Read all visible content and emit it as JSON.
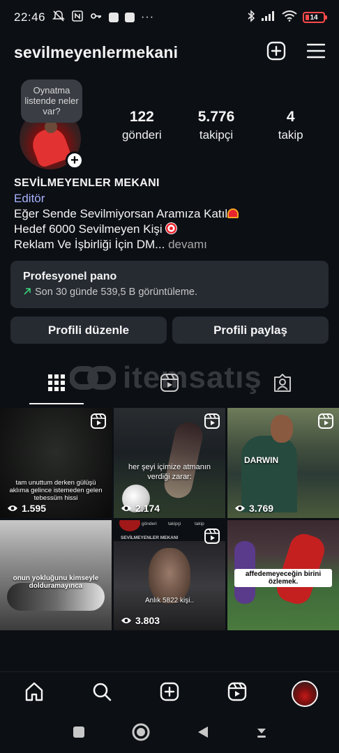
{
  "status_bar": {
    "time": "22:46",
    "battery": "14",
    "icons": [
      "mute-icon",
      "nfc-icon",
      "key-icon",
      "app-icon",
      "app-icon",
      "more-icon",
      "bluetooth-icon",
      "signal-icon",
      "wifi-icon",
      "battery-icon"
    ]
  },
  "header": {
    "username": "sevilmeyenlermekani",
    "icons": [
      "create-post-icon",
      "menu-icon"
    ]
  },
  "profile": {
    "note": "Oynatma listende neler var?",
    "stats": [
      {
        "value": "122",
        "label": "gönderi"
      },
      {
        "value": "5.776",
        "label": "takipçi"
      },
      {
        "value": "4",
        "label": "takip"
      }
    ],
    "display_name": "SEVİLMEYENLER MEKANI",
    "category": "Editör",
    "bio_line1": "Eğer Sende Sevilmiyorsan Aramıza Katıl",
    "bio_line2": "Hedef 6000 Sevilmeyen Kişi",
    "bio_line3": "Reklam Ve İşbirliği İçin DM...",
    "more": "devamı"
  },
  "dashboard": {
    "title": "Profesyonel pano",
    "subtitle": "Son 30 günde 539,5 B görüntüleme."
  },
  "buttons": {
    "edit_profile": "Profili düzenle",
    "share_profile": "Profili paylaş"
  },
  "tabs": [
    {
      "icon": "grid-icon",
      "active": true
    },
    {
      "icon": "reels-icon",
      "active": false
    },
    {
      "icon": "tagged-icon",
      "active": false
    }
  ],
  "watermark": "itemsatış",
  "posts": [
    {
      "views": "1.595",
      "caption": "tam unuttum derken gülüşü aklıma gelince istemeden gelen tebessüm hissi"
    },
    {
      "views": "2.174",
      "caption": "her şeyi içimize atmanın verdiği zarar:"
    },
    {
      "views": "3.769",
      "caption": "DARWIN"
    },
    {
      "views": "",
      "caption": "onun yokluğunu kimseyle dolduramayınca"
    },
    {
      "views": "3.803",
      "caption": "Anlık 5822 kişi..",
      "mini_stats": [
        "gönderi",
        "takipçi",
        "takip"
      ],
      "mini_name": "SEVİLMEYENLER MEKANI"
    },
    {
      "views": "",
      "caption": "affedemeyeceğin birini özlemek."
    }
  ],
  "bottom_nav": [
    "home-icon",
    "search-icon",
    "create-icon",
    "reels-icon",
    "profile-avatar"
  ],
  "system_nav": [
    "recents-icon",
    "home-circle-icon",
    "back-icon",
    "hide-nav-icon"
  ]
}
